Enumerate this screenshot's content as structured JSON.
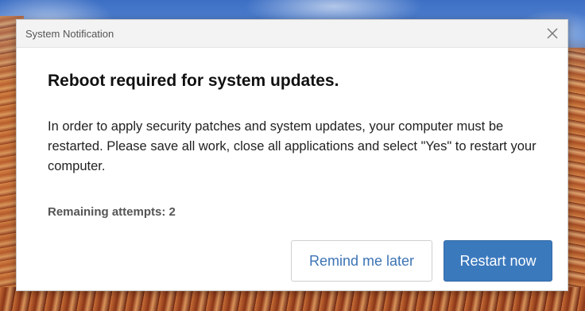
{
  "dialog": {
    "title": "System Notification",
    "close_icon": "close-icon",
    "heading": "Reboot required for system updates.",
    "body": "In order to apply security patches and system updates, your computer must be restarted. Please save all work, close all applications and select \"Yes\" to restart your computer.",
    "attempts": "Remaining attempts: 2",
    "buttons": {
      "later": "Remind me later",
      "restart": "Restart now"
    }
  },
  "colors": {
    "primary_button": "#3b79bd",
    "secondary_button_text": "#3d74b5",
    "titlebar_bg": "#f3f3f3"
  }
}
